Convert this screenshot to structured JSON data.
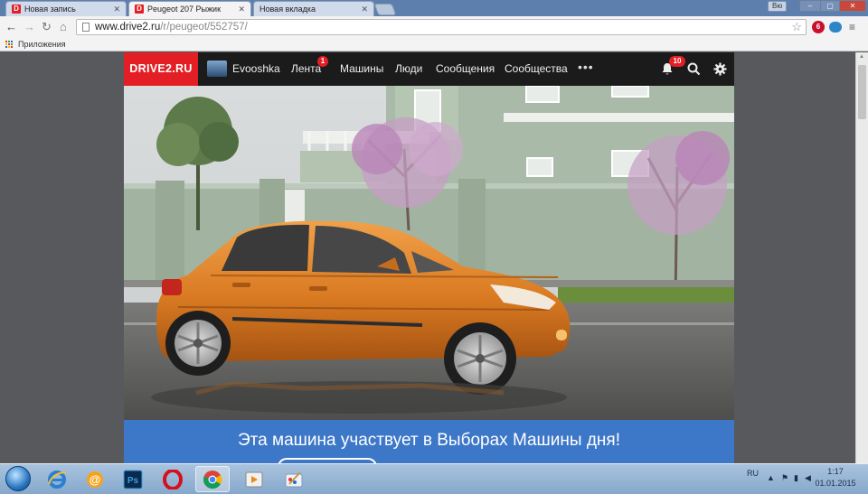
{
  "browser": {
    "tabs": [
      {
        "favicon": "D",
        "title": "Новая запись"
      },
      {
        "favicon": "D",
        "title": "Peugeot 207 Рыжик"
      },
      {
        "favicon": "",
        "title": "Новая вкладка"
      }
    ],
    "window_user": "Вю",
    "url_host": "www.drive2.ru",
    "url_path": "/r/peugeot/552757/",
    "bookmarks_apps_label": "Приложения",
    "extension_badge": "6"
  },
  "site": {
    "logo": "DRIVE2.RU",
    "username": "Evooshka",
    "nav": {
      "feed": "Лента",
      "feed_badge": "1",
      "cars": "Машины",
      "people": "Люди",
      "messages": "Сообщения",
      "communities": "Сообщества",
      "more": "•••"
    },
    "notifications_badge": "10",
    "banner_text": "Эта машина участвует в Выборах Машины дня!"
  },
  "taskbar": {
    "lang": "RU",
    "time": "1:17",
    "date": "01.01.2015"
  }
}
